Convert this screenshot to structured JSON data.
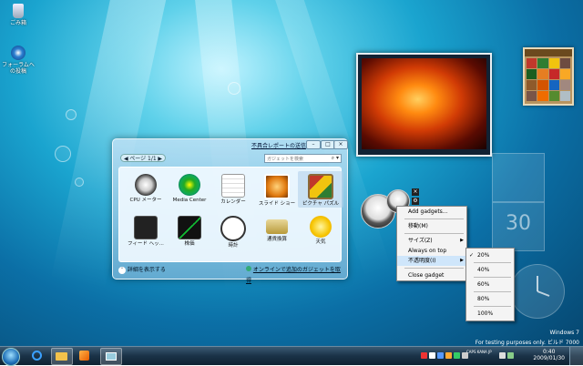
{
  "desktop": {
    "icons": [
      {
        "label": "ごみ箱",
        "icon": "recycle-bin-icon"
      },
      {
        "label": "フォーラムへの投稿",
        "icon": "forum-post-icon"
      }
    ]
  },
  "gallery": {
    "problem_link": "不具合レポートの送信",
    "page_label": "ページ 1/1",
    "search_placeholder": "ガジェットを検索",
    "items": [
      {
        "label": "CPU メーター",
        "icon": "cpu-meter-icon"
      },
      {
        "label": "Media Center",
        "icon": "media-center-icon"
      },
      {
        "label": "カレンダー",
        "icon": "calendar-icon"
      },
      {
        "label": "スライド ショー",
        "icon": "slideshow-icon"
      },
      {
        "label": "ピクチャ パズル",
        "icon": "picture-puzzle-icon"
      },
      {
        "label": "フィード ヘッ...",
        "icon": "feed-headlines-icon"
      },
      {
        "label": "株価",
        "icon": "stocks-icon"
      },
      {
        "label": "時計",
        "icon": "clock-icon"
      },
      {
        "label": "通貨換算",
        "icon": "currency-icon"
      },
      {
        "label": "天気",
        "icon": "weather-icon"
      }
    ],
    "show_details": "詳細を表示する",
    "online_link": "オンラインで追加のガジェットを取得"
  },
  "calendar_gadget": {
    "day": "30"
  },
  "context_menu": {
    "items": [
      {
        "label": "Add gadgets..."
      },
      {
        "label": "移動(M)"
      },
      {
        "label": "サイズ(Z)",
        "submenu": true
      },
      {
        "label": "Always on top"
      },
      {
        "label": "不透明度(I)",
        "submenu": true,
        "highlighted": true
      },
      {
        "label": "Close gadget"
      }
    ],
    "opacity_options": [
      {
        "label": "20%",
        "checked": true
      },
      {
        "label": "40%"
      },
      {
        "label": "60%"
      },
      {
        "label": "80%"
      },
      {
        "label": "100%"
      }
    ]
  },
  "watermark": {
    "line1": "Windows 7",
    "line2": "For testing purposes only. ビルド 7000"
  },
  "taskbar": {
    "time": "0:40",
    "date": "2009/01/30",
    "language": "JP",
    "tray_labels": "CAPS KANA"
  },
  "colors": {
    "accent": "#1aa4cf",
    "menu_highlight": "#cfe6fb",
    "taskbar": "#1a3247"
  }
}
